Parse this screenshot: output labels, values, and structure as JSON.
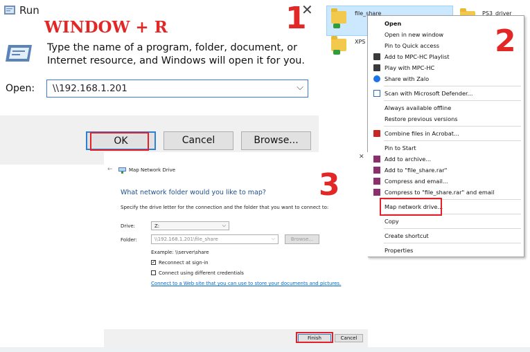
{
  "annotations": {
    "step1": "1",
    "step2": "2",
    "step3": "3",
    "shortcut": "WINDOW + R"
  },
  "run_dialog": {
    "title": "Run",
    "close": "✕",
    "description": "Type the name of a program, folder, document, or Internet resource, and Windows will open it for you.",
    "open_label": "Open:",
    "open_value": "\\\\192.168.1.201",
    "ok": "OK",
    "cancel": "Cancel",
    "browse": "Browse..."
  },
  "explorer": {
    "items": [
      "file_share",
      "XPS",
      "PS3_driver"
    ]
  },
  "context_menu": {
    "items": [
      "Open",
      "Open in new window",
      "Pin to Quick access",
      "Add to MPC-HC Playlist",
      "Play with MPC-HC",
      "Share with Zalo",
      "Scan with Microsoft Defender...",
      "Always available offline",
      "Restore previous versions",
      "Combine files in Acrobat...",
      "Pin to Start",
      "Add to archive...",
      "Add to \"file_share.rar\"",
      "Compress and email...",
      "Compress to \"file_share.rar\" and email",
      "Map network drive...",
      "Copy",
      "Create shortcut",
      "Properties"
    ]
  },
  "map_drive": {
    "back": "←",
    "title": "Map Network Drive",
    "close": "✕",
    "heading": "What network folder would you like to map?",
    "instruction": "Specify the drive letter for the connection and the folder that you want to connect to:",
    "drive_label": "Drive:",
    "drive_value": "Z:",
    "folder_label": "Folder:",
    "folder_value": "\\\\192.168.1.201\\file_share",
    "browse": "Browse...",
    "example": "Example: \\\\server\\share",
    "reconnect": "Reconnect at sign-in",
    "different_creds": "Connect using different credentials",
    "link": "Connect to a Web site that you can use to store your documents and pictures.",
    "finish": "Finish",
    "cancel": "Cancel"
  },
  "colors": {
    "annotation_red": "#e22727",
    "accent_blue": "#2d7fd3",
    "link_blue": "#0066cc",
    "heading_blue": "#1e4e8c"
  }
}
